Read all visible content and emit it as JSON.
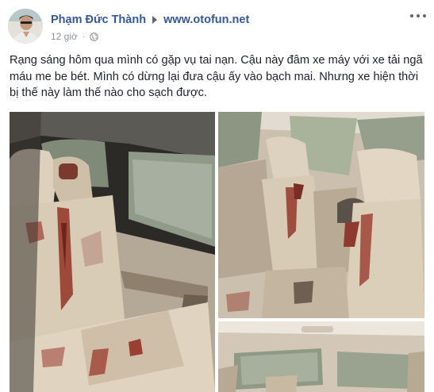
{
  "post": {
    "author": "Phạm Đức Thành",
    "page": "www.otofun.net",
    "time": "12 giờ",
    "separator": "·",
    "text": "Rạng sáng hôm qua mình có gặp vụ tai nạn. Cậu này đâm xe máy với xe tải ngã máu me be bét. Mình có dừng lại đưa cậu ấy vào bạch mai. Nhưng xe hiện thời bị thế này làm thế nào cho sạch được.",
    "privacy_icon": "globe-icon",
    "menu_icon": "more-options-icon"
  },
  "colors": {
    "link": "#365899",
    "text": "#1d2129",
    "meta": "#90949c",
    "seat": "#d8cbb8",
    "blood": "#8a2b24"
  }
}
